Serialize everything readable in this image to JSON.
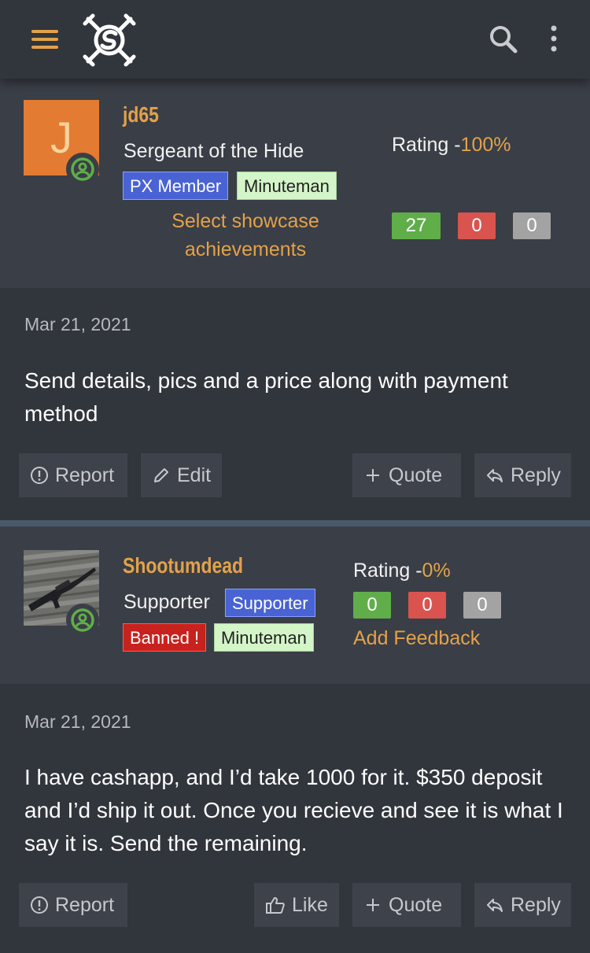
{
  "colors": {
    "accent": "#e3a24a",
    "background": "#31353c",
    "userbar": "#3a3e46",
    "tag_blue": "#4a63d4",
    "tag_green": "#d3f5c8",
    "tag_red": "#c8221e",
    "count_green": "#5fae4a",
    "count_red": "#d9534f",
    "count_gray": "#a3a3a3"
  },
  "header": {
    "menu_icon": "hamburger-menu-icon",
    "logo_icon": "site-logo-icon",
    "search_icon": "search-icon",
    "more_icon": "more-vertical-icon"
  },
  "posts": [
    {
      "avatar_letter": "J",
      "username": "jd65",
      "user_title": "Sergeant of the Hide",
      "tags": [
        "PX Member",
        "Minuteman"
      ],
      "showcase_link": "Select showcase achievements",
      "rating_label": "Rating -",
      "rating_value": "100%",
      "counts": [
        "27",
        "0",
        "0"
      ],
      "date": "Mar 21, 2021",
      "text": "Send details, pics and a price along with payment method",
      "actions": [
        "Report",
        "Edit",
        "Quote",
        "Reply"
      ]
    },
    {
      "avatar_image": "rifle-photo",
      "username": "Shootumdead",
      "user_title": "Supporter",
      "tags": [
        "Supporter",
        "Banned !",
        "Minuteman"
      ],
      "rating_label": "Rating -",
      "rating_value": "0%",
      "counts": [
        "0",
        "0",
        "0"
      ],
      "feedback_link": "Add Feedback",
      "date": "Mar 21, 2021",
      "text": "I have cashapp, and I’d take 1000 for it. $350 deposit and I’d ship it out. Once you recieve and see it is what I say it is. Send the remaining.",
      "actions": [
        "Report",
        "Like",
        "Quote",
        "Reply"
      ]
    }
  ]
}
